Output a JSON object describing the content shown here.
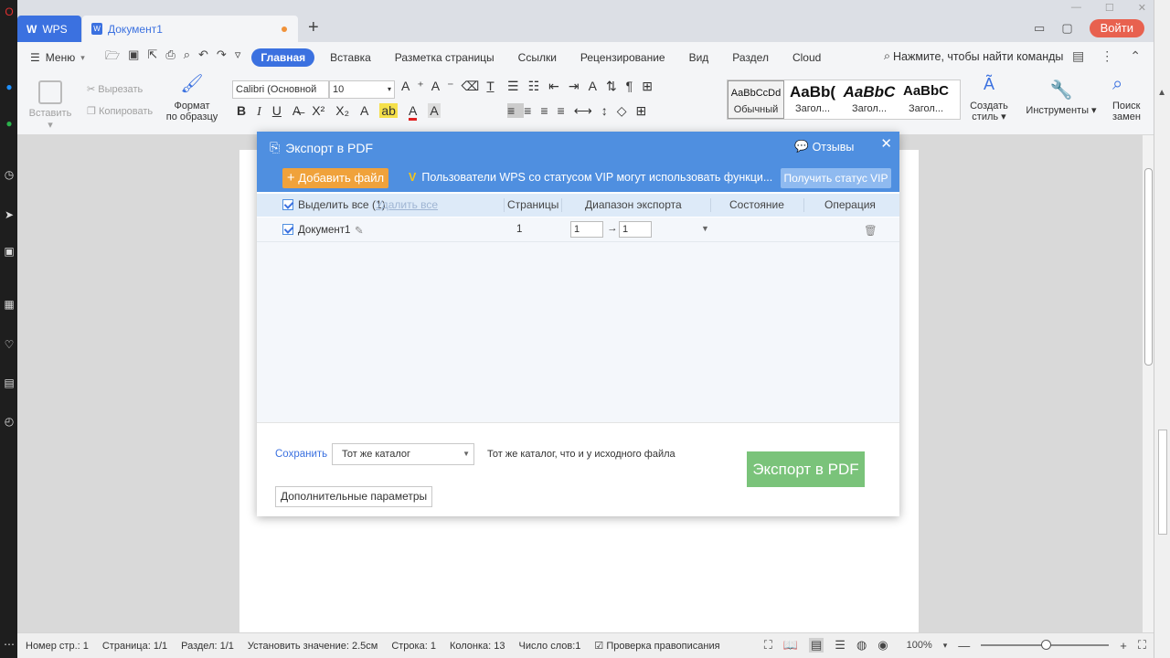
{
  "tabs": {
    "wps_label": "WPS",
    "doc_label": "Документ1",
    "new_tab": "+"
  },
  "titlebar": {
    "login_label": "Войти"
  },
  "menu": {
    "menu_label": "Меню",
    "tabs": [
      "Главная",
      "Вставка",
      "Разметка страницы",
      "Ссылки",
      "Рецензирование",
      "Вид",
      "Раздел",
      "Cloud"
    ],
    "search_placeholder": "Нажмите, чтобы найти команды"
  },
  "ribbon": {
    "paste": "Вставить",
    "cut": "Вырезать",
    "copy": "Копировать",
    "format_painter_1": "Формат",
    "format_painter_2": "по образцу",
    "font_name": "Calibri (Основной",
    "font_size": "10",
    "styles": [
      {
        "sample": "AaBbCcDd",
        "name": "Обычный"
      },
      {
        "sample": "AaBb(",
        "name": "Загол..."
      },
      {
        "sample": "AaBbC",
        "name": "Загол..."
      },
      {
        "sample": "AaBbC",
        "name": "Загол..."
      }
    ],
    "create_style_1": "Создать",
    "create_style_2": "стиль",
    "tools": "Инструменты",
    "find_1": "Поиск",
    "find_2": "замен"
  },
  "dialog": {
    "title": "Экспорт в PDF",
    "feedback": "Отзывы",
    "add_file": "Добавить файл",
    "vip_note": "Пользователи WPS со статусом VIP могут использовать функци...",
    "vip_button": "Получить статус VIP",
    "header": {
      "select_all": "Выделить все (1)",
      "delete_all": "Удалить все",
      "pages": "Страницы",
      "range": "Диапазон экспорта",
      "state": "Состояние",
      "operation": "Операция"
    },
    "rows": [
      {
        "name": "Документ1",
        "pages": "1",
        "from": "1",
        "to": "1"
      }
    ],
    "save_label": "Сохранить",
    "save_option": "Тот же каталог",
    "save_desc": "Тот же каталог, что и у исходного файла",
    "export_button": "Экспорт в PDF",
    "advanced_button": "Дополнительные параметры"
  },
  "status": {
    "page_num": "Номер стр.: 1",
    "page": "Страница: 1/1",
    "section": "Раздел: 1/1",
    "set_value": "Установить значение: 2.5см",
    "line": "Строка: 1",
    "column": "Колонка: 13",
    "words": "Число слов:1",
    "spellcheck": "Проверка правописания",
    "zoom": "100%"
  }
}
